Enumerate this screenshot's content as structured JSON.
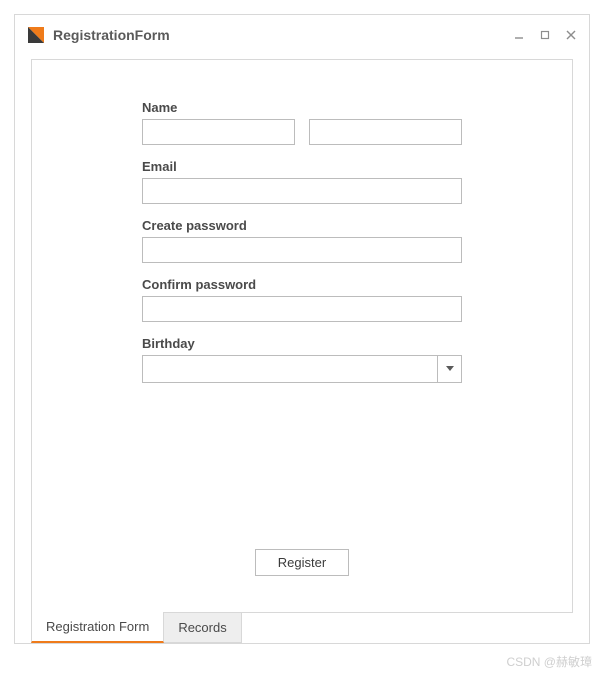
{
  "window": {
    "title": "RegistrationForm"
  },
  "form": {
    "name_label": "Name",
    "first_name": "",
    "last_name": "",
    "email_label": "Email",
    "email": "",
    "create_pw_label": "Create password",
    "create_pw": "",
    "confirm_pw_label": "Confirm password",
    "confirm_pw": "",
    "birthday_label": "Birthday",
    "birthday": "",
    "register_btn": "Register"
  },
  "tabs": {
    "registration": "Registration Form",
    "records": "Records"
  },
  "watermark": "CSDN @赫敏璋",
  "colors": {
    "accent": "#ef7b1a",
    "border": "#d8d8d8",
    "field_border": "#bcbcbc"
  }
}
